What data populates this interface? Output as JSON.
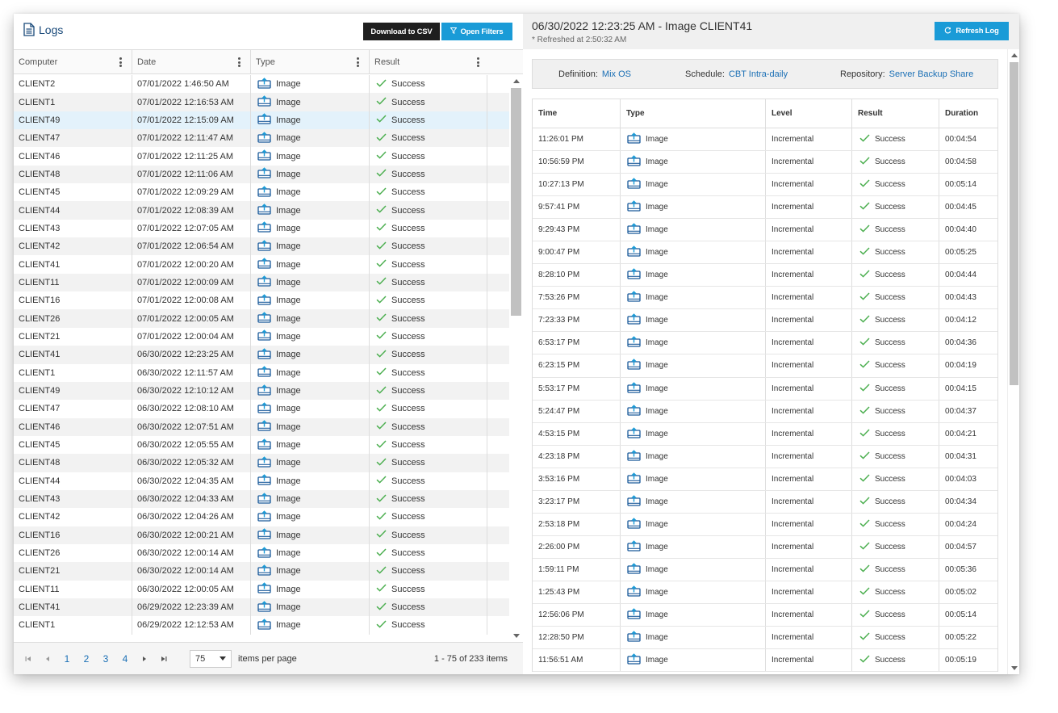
{
  "colors": {
    "accent": "#1a9bd7",
    "dark_button": "#1f1f1f",
    "link": "#1a6fb5",
    "success_check": "#4caf50",
    "selected_row": "#e3f2fb"
  },
  "logs": {
    "title": "Logs",
    "download_label": "Download to CSV",
    "filters_label": "Open Filters",
    "columns": [
      "Computer",
      "Date",
      "Type",
      "Result"
    ],
    "rows": [
      {
        "computer": "CLIENT2",
        "date": "07/01/2022 1:46:50 AM",
        "type": "Image",
        "result": "Success"
      },
      {
        "computer": "CLIENT1",
        "date": "07/01/2022 12:16:53 AM",
        "type": "Image",
        "result": "Success"
      },
      {
        "computer": "CLIENT49",
        "date": "07/01/2022 12:15:09 AM",
        "type": "Image",
        "result": "Success",
        "selected": true
      },
      {
        "computer": "CLIENT47",
        "date": "07/01/2022 12:11:47 AM",
        "type": "Image",
        "result": "Success"
      },
      {
        "computer": "CLIENT46",
        "date": "07/01/2022 12:11:25 AM",
        "type": "Image",
        "result": "Success"
      },
      {
        "computer": "CLIENT48",
        "date": "07/01/2022 12:11:06 AM",
        "type": "Image",
        "result": "Success"
      },
      {
        "computer": "CLIENT45",
        "date": "07/01/2022 12:09:29 AM",
        "type": "Image",
        "result": "Success"
      },
      {
        "computer": "CLIENT44",
        "date": "07/01/2022 12:08:39 AM",
        "type": "Image",
        "result": "Success"
      },
      {
        "computer": "CLIENT43",
        "date": "07/01/2022 12:07:05 AM",
        "type": "Image",
        "result": "Success"
      },
      {
        "computer": "CLIENT42",
        "date": "07/01/2022 12:06:54 AM",
        "type": "Image",
        "result": "Success"
      },
      {
        "computer": "CLIENT41",
        "date": "07/01/2022 12:00:20 AM",
        "type": "Image",
        "result": "Success"
      },
      {
        "computer": "CLIENT11",
        "date": "07/01/2022 12:00:09 AM",
        "type": "Image",
        "result": "Success"
      },
      {
        "computer": "CLIENT16",
        "date": "07/01/2022 12:00:08 AM",
        "type": "Image",
        "result": "Success"
      },
      {
        "computer": "CLIENT26",
        "date": "07/01/2022 12:00:05 AM",
        "type": "Image",
        "result": "Success"
      },
      {
        "computer": "CLIENT21",
        "date": "07/01/2022 12:00:04 AM",
        "type": "Image",
        "result": "Success"
      },
      {
        "computer": "CLIENT41",
        "date": "06/30/2022 12:23:25 AM",
        "type": "Image",
        "result": "Success"
      },
      {
        "computer": "CLIENT1",
        "date": "06/30/2022 12:11:57 AM",
        "type": "Image",
        "result": "Success"
      },
      {
        "computer": "CLIENT49",
        "date": "06/30/2022 12:10:12 AM",
        "type": "Image",
        "result": "Success"
      },
      {
        "computer": "CLIENT47",
        "date": "06/30/2022 12:08:10 AM",
        "type": "Image",
        "result": "Success"
      },
      {
        "computer": "CLIENT46",
        "date": "06/30/2022 12:07:51 AM",
        "type": "Image",
        "result": "Success"
      },
      {
        "computer": "CLIENT45",
        "date": "06/30/2022 12:05:55 AM",
        "type": "Image",
        "result": "Success"
      },
      {
        "computer": "CLIENT48",
        "date": "06/30/2022 12:05:32 AM",
        "type": "Image",
        "result": "Success"
      },
      {
        "computer": "CLIENT44",
        "date": "06/30/2022 12:04:35 AM",
        "type": "Image",
        "result": "Success"
      },
      {
        "computer": "CLIENT43",
        "date": "06/30/2022 12:04:33 AM",
        "type": "Image",
        "result": "Success"
      },
      {
        "computer": "CLIENT42",
        "date": "06/30/2022 12:04:26 AM",
        "type": "Image",
        "result": "Success"
      },
      {
        "computer": "CLIENT16",
        "date": "06/30/2022 12:00:21 AM",
        "type": "Image",
        "result": "Success"
      },
      {
        "computer": "CLIENT26",
        "date": "06/30/2022 12:00:14 AM",
        "type": "Image",
        "result": "Success"
      },
      {
        "computer": "CLIENT21",
        "date": "06/30/2022 12:00:14 AM",
        "type": "Image",
        "result": "Success"
      },
      {
        "computer": "CLIENT11",
        "date": "06/30/2022 12:00:05 AM",
        "type": "Image",
        "result": "Success"
      },
      {
        "computer": "CLIENT41",
        "date": "06/29/2022 12:23:39 AM",
        "type": "Image",
        "result": "Success"
      },
      {
        "computer": "CLIENT1",
        "date": "06/29/2022 12:12:53 AM",
        "type": "Image",
        "result": "Success"
      }
    ],
    "pager": {
      "pages": [
        "1",
        "2",
        "3",
        "4"
      ],
      "page_size": "75",
      "items_per_page_label": "items per page",
      "count_label": "1 - 75 of 233 items"
    }
  },
  "detail": {
    "title": "06/30/2022 12:23:25 AM - Image CLIENT41",
    "subtitle": "* Refreshed at 2:50:32 AM",
    "refresh_label": "Refresh Log",
    "definition_label": "Definition:",
    "definition_value": "Mix OS",
    "schedule_label": "Schedule:",
    "schedule_value": "CBT Intra-daily",
    "repository_label": "Repository:",
    "repository_value": "Server Backup Share",
    "columns": [
      "Time",
      "Type",
      "Level",
      "Result",
      "Duration"
    ],
    "rows": [
      {
        "time": "11:26:01 PM",
        "type": "Image",
        "level": "Incremental",
        "result": "Success",
        "duration": "00:04:54"
      },
      {
        "time": "10:56:59 PM",
        "type": "Image",
        "level": "Incremental",
        "result": "Success",
        "duration": "00:04:58"
      },
      {
        "time": "10:27:13 PM",
        "type": "Image",
        "level": "Incremental",
        "result": "Success",
        "duration": "00:05:14"
      },
      {
        "time": "9:57:41 PM",
        "type": "Image",
        "level": "Incremental",
        "result": "Success",
        "duration": "00:04:45"
      },
      {
        "time": "9:29:43 PM",
        "type": "Image",
        "level": "Incremental",
        "result": "Success",
        "duration": "00:04:40"
      },
      {
        "time": "9:00:47 PM",
        "type": "Image",
        "level": "Incremental",
        "result": "Success",
        "duration": "00:05:25"
      },
      {
        "time": "8:28:10 PM",
        "type": "Image",
        "level": "Incremental",
        "result": "Success",
        "duration": "00:04:44"
      },
      {
        "time": "7:53:26 PM",
        "type": "Image",
        "level": "Incremental",
        "result": "Success",
        "duration": "00:04:43"
      },
      {
        "time": "7:23:33 PM",
        "type": "Image",
        "level": "Incremental",
        "result": "Success",
        "duration": "00:04:12"
      },
      {
        "time": "6:53:17 PM",
        "type": "Image",
        "level": "Incremental",
        "result": "Success",
        "duration": "00:04:36"
      },
      {
        "time": "6:23:15 PM",
        "type": "Image",
        "level": "Incremental",
        "result": "Success",
        "duration": "00:04:19"
      },
      {
        "time": "5:53:17 PM",
        "type": "Image",
        "level": "Incremental",
        "result": "Success",
        "duration": "00:04:15"
      },
      {
        "time": "5:24:47 PM",
        "type": "Image",
        "level": "Incremental",
        "result": "Success",
        "duration": "00:04:37"
      },
      {
        "time": "4:53:15 PM",
        "type": "Image",
        "level": "Incremental",
        "result": "Success",
        "duration": "00:04:21"
      },
      {
        "time": "4:23:18 PM",
        "type": "Image",
        "level": "Incremental",
        "result": "Success",
        "duration": "00:04:31"
      },
      {
        "time": "3:53:16 PM",
        "type": "Image",
        "level": "Incremental",
        "result": "Success",
        "duration": "00:04:03"
      },
      {
        "time": "3:23:17 PM",
        "type": "Image",
        "level": "Incremental",
        "result": "Success",
        "duration": "00:04:34"
      },
      {
        "time": "2:53:18 PM",
        "type": "Image",
        "level": "Incremental",
        "result": "Success",
        "duration": "00:04:24"
      },
      {
        "time": "2:26:00 PM",
        "type": "Image",
        "level": "Incremental",
        "result": "Success",
        "duration": "00:04:57"
      },
      {
        "time": "1:59:11 PM",
        "type": "Image",
        "level": "Incremental",
        "result": "Success",
        "duration": "00:05:36"
      },
      {
        "time": "1:25:43 PM",
        "type": "Image",
        "level": "Incremental",
        "result": "Success",
        "duration": "00:05:02"
      },
      {
        "time": "12:56:06 PM",
        "type": "Image",
        "level": "Incremental",
        "result": "Success",
        "duration": "00:05:14"
      },
      {
        "time": "12:28:50 PM",
        "type": "Image",
        "level": "Incremental",
        "result": "Success",
        "duration": "00:05:22"
      },
      {
        "time": "11:56:51 AM",
        "type": "Image",
        "level": "Incremental",
        "result": "Success",
        "duration": "00:05:19"
      }
    ]
  }
}
